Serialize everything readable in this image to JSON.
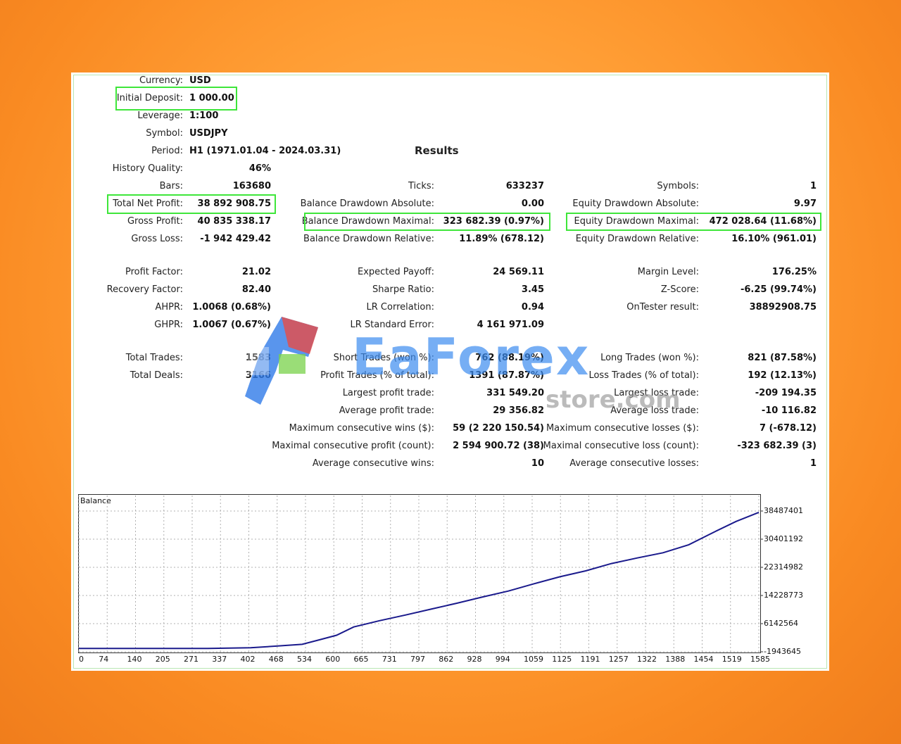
{
  "left_col": [
    {
      "label": "Currency:",
      "value": "USD"
    },
    {
      "label": "Initial Deposit:",
      "value": "1 000.00"
    },
    {
      "label": "Leverage:",
      "value": "1:100"
    },
    {
      "label": "Symbol:",
      "value": "USDJPY"
    },
    {
      "label": "Period:",
      "value": "H1 (1971.01.04 - 2024.03.31)"
    },
    {
      "label": "History Quality:",
      "value": "46%"
    },
    {
      "label": "Bars:",
      "value": "163680"
    },
    {
      "label": "Total Net Profit:",
      "value": "38 892 908.75"
    },
    {
      "label": "Gross Profit:",
      "value": "40 835 338.17"
    },
    {
      "label": "Gross Loss:",
      "value": "-1 942 429.42"
    },
    {
      "label": "Profit Factor:",
      "value": "21.02"
    },
    {
      "label": "Recovery Factor:",
      "value": "82.40"
    },
    {
      "label": "AHPR:",
      "value": "1.0068 (0.68%)"
    },
    {
      "label": "GHPR:",
      "value": "1.0067 (0.67%)"
    },
    {
      "label": "Total Trades:",
      "value": "1583"
    },
    {
      "label": "Total Deals:",
      "value": "3166"
    }
  ],
  "results_title": "Results",
  "mid_col": [
    {
      "label": "Ticks:",
      "value": "633237"
    },
    {
      "label": "Balance Drawdown Absolute:",
      "value": "0.00"
    },
    {
      "label": "Balance Drawdown Maximal:",
      "value": "323 682.39 (0.97%)"
    },
    {
      "label": "Balance Drawdown Relative:",
      "value": "11.89% (678.12)"
    },
    {
      "label": "Expected Payoff:",
      "value": "24 569.11"
    },
    {
      "label": "Sharpe Ratio:",
      "value": "3.45"
    },
    {
      "label": "LR Correlation:",
      "value": "0.94"
    },
    {
      "label": "LR Standard Error:",
      "value": "4 161 971.09"
    },
    {
      "label": "Short Trades (won %):",
      "value": "762 (88.19%)"
    },
    {
      "label": "Profit Trades (% of total):",
      "value": "1391 (87.87%)"
    },
    {
      "label": "Largest profit trade:",
      "value": "331 549.20"
    },
    {
      "label": "Average profit trade:",
      "value": "29 356.82"
    },
    {
      "label": "Maximum consecutive wins ($):",
      "value": "59 (2 220 150.54)"
    },
    {
      "label": "Maximal consecutive profit (count):",
      "value": "2 594 900.72 (38)"
    },
    {
      "label": "Average consecutive wins:",
      "value": "10"
    }
  ],
  "right_col": [
    {
      "label": "Symbols:",
      "value": "1"
    },
    {
      "label": "Equity Drawdown Absolute:",
      "value": "9.97"
    },
    {
      "label": "Equity Drawdown Maximal:",
      "value": "472 028.64 (11.68%)"
    },
    {
      "label": "Equity Drawdown Relative:",
      "value": "16.10% (961.01)"
    },
    {
      "label": "Margin Level:",
      "value": "176.25%"
    },
    {
      "label": "Z-Score:",
      "value": "-6.25 (99.74%)"
    },
    {
      "label": "OnTester result:",
      "value": "38892908.75"
    },
    {
      "label": "Long Trades (won %):",
      "value": "821 (87.58%)"
    },
    {
      "label": "Loss Trades (% of total):",
      "value": "192 (12.13%)"
    },
    {
      "label": "Largest loss trade:",
      "value": "-209 194.35"
    },
    {
      "label": "Average loss trade:",
      "value": "-10 116.82"
    },
    {
      "label": "Maximum consecutive losses ($):",
      "value": "7 (-678.12)"
    },
    {
      "label": "Maximal consecutive loss (count):",
      "value": "-323 682.39 (3)"
    },
    {
      "label": "Average consecutive losses:",
      "value": "1"
    }
  ],
  "watermark": {
    "main": "EaForex",
    "sub": "store.com"
  },
  "colors": {
    "highlight": "#3ee63a",
    "line": "#1a1a8c",
    "grid": "#b0b0b0",
    "background": "#ff9d34"
  },
  "chart_data": {
    "type": "line",
    "title": "Balance",
    "x_ticks": [
      "0",
      "74",
      "140",
      "205",
      "271",
      "337",
      "402",
      "468",
      "534",
      "600",
      "665",
      "731",
      "797",
      "862",
      "928",
      "994",
      "1059",
      "1125",
      "1191",
      "1257",
      "1322",
      "1388",
      "1454",
      "1519",
      "1585"
    ],
    "y_ticks": [
      "38487401",
      "30401192",
      "22314982",
      "14228773",
      "6142564",
      "-1943645"
    ],
    "ylim": [
      -1943645,
      38487401
    ],
    "xlim": [
      0,
      1583
    ],
    "grid": true,
    "series": [
      {
        "x": [
          0,
          150,
          300,
          400,
          460,
          520,
          560,
          600,
          640,
          700,
          760,
          820,
          880,
          940,
          1000,
          1060,
          1120,
          1180,
          1240,
          1300,
          1360,
          1420,
          1480,
          1530,
          1583
        ],
        "y": [
          -1000000,
          -1000000,
          -1000000,
          -800000,
          -300000,
          200000,
          1500000,
          2800000,
          5200000,
          7000000,
          8600000,
          10300000,
          12000000,
          13800000,
          15500000,
          17600000,
          19600000,
          21300000,
          23400000,
          25000000,
          26500000,
          28800000,
          32500000,
          35500000,
          38100000
        ]
      }
    ]
  }
}
